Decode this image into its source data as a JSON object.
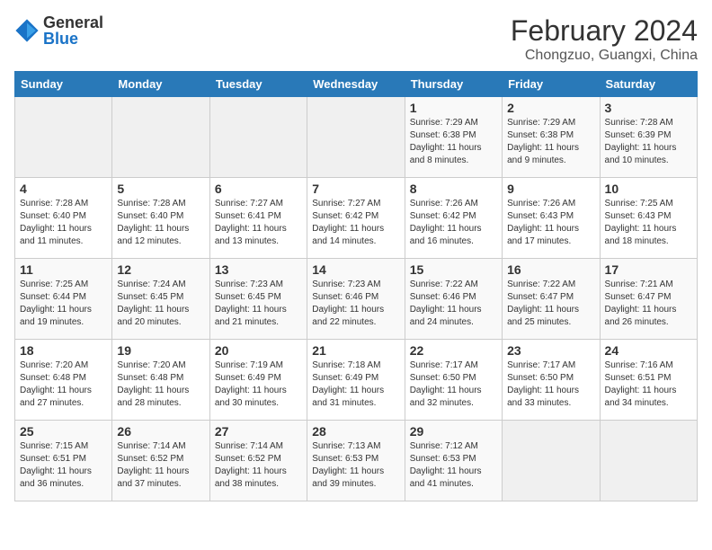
{
  "header": {
    "logo_general": "General",
    "logo_blue": "Blue",
    "title": "February 2024",
    "subtitle": "Chongzuo, Guangxi, China"
  },
  "days_of_week": [
    "Sunday",
    "Monday",
    "Tuesday",
    "Wednesday",
    "Thursday",
    "Friday",
    "Saturday"
  ],
  "weeks": [
    [
      {
        "day": "",
        "info": ""
      },
      {
        "day": "",
        "info": ""
      },
      {
        "day": "",
        "info": ""
      },
      {
        "day": "",
        "info": ""
      },
      {
        "day": "1",
        "info": "Sunrise: 7:29 AM\nSunset: 6:38 PM\nDaylight: 11 hours and 8 minutes."
      },
      {
        "day": "2",
        "info": "Sunrise: 7:29 AM\nSunset: 6:38 PM\nDaylight: 11 hours and 9 minutes."
      },
      {
        "day": "3",
        "info": "Sunrise: 7:28 AM\nSunset: 6:39 PM\nDaylight: 11 hours and 10 minutes."
      }
    ],
    [
      {
        "day": "4",
        "info": "Sunrise: 7:28 AM\nSunset: 6:40 PM\nDaylight: 11 hours and 11 minutes."
      },
      {
        "day": "5",
        "info": "Sunrise: 7:28 AM\nSunset: 6:40 PM\nDaylight: 11 hours and 12 minutes."
      },
      {
        "day": "6",
        "info": "Sunrise: 7:27 AM\nSunset: 6:41 PM\nDaylight: 11 hours and 13 minutes."
      },
      {
        "day": "7",
        "info": "Sunrise: 7:27 AM\nSunset: 6:42 PM\nDaylight: 11 hours and 14 minutes."
      },
      {
        "day": "8",
        "info": "Sunrise: 7:26 AM\nSunset: 6:42 PM\nDaylight: 11 hours and 16 minutes."
      },
      {
        "day": "9",
        "info": "Sunrise: 7:26 AM\nSunset: 6:43 PM\nDaylight: 11 hours and 17 minutes."
      },
      {
        "day": "10",
        "info": "Sunrise: 7:25 AM\nSunset: 6:43 PM\nDaylight: 11 hours and 18 minutes."
      }
    ],
    [
      {
        "day": "11",
        "info": "Sunrise: 7:25 AM\nSunset: 6:44 PM\nDaylight: 11 hours and 19 minutes."
      },
      {
        "day": "12",
        "info": "Sunrise: 7:24 AM\nSunset: 6:45 PM\nDaylight: 11 hours and 20 minutes."
      },
      {
        "day": "13",
        "info": "Sunrise: 7:23 AM\nSunset: 6:45 PM\nDaylight: 11 hours and 21 minutes."
      },
      {
        "day": "14",
        "info": "Sunrise: 7:23 AM\nSunset: 6:46 PM\nDaylight: 11 hours and 22 minutes."
      },
      {
        "day": "15",
        "info": "Sunrise: 7:22 AM\nSunset: 6:46 PM\nDaylight: 11 hours and 24 minutes."
      },
      {
        "day": "16",
        "info": "Sunrise: 7:22 AM\nSunset: 6:47 PM\nDaylight: 11 hours and 25 minutes."
      },
      {
        "day": "17",
        "info": "Sunrise: 7:21 AM\nSunset: 6:47 PM\nDaylight: 11 hours and 26 minutes."
      }
    ],
    [
      {
        "day": "18",
        "info": "Sunrise: 7:20 AM\nSunset: 6:48 PM\nDaylight: 11 hours and 27 minutes."
      },
      {
        "day": "19",
        "info": "Sunrise: 7:20 AM\nSunset: 6:48 PM\nDaylight: 11 hours and 28 minutes."
      },
      {
        "day": "20",
        "info": "Sunrise: 7:19 AM\nSunset: 6:49 PM\nDaylight: 11 hours and 30 minutes."
      },
      {
        "day": "21",
        "info": "Sunrise: 7:18 AM\nSunset: 6:49 PM\nDaylight: 11 hours and 31 minutes."
      },
      {
        "day": "22",
        "info": "Sunrise: 7:17 AM\nSunset: 6:50 PM\nDaylight: 11 hours and 32 minutes."
      },
      {
        "day": "23",
        "info": "Sunrise: 7:17 AM\nSunset: 6:50 PM\nDaylight: 11 hours and 33 minutes."
      },
      {
        "day": "24",
        "info": "Sunrise: 7:16 AM\nSunset: 6:51 PM\nDaylight: 11 hours and 34 minutes."
      }
    ],
    [
      {
        "day": "25",
        "info": "Sunrise: 7:15 AM\nSunset: 6:51 PM\nDaylight: 11 hours and 36 minutes."
      },
      {
        "day": "26",
        "info": "Sunrise: 7:14 AM\nSunset: 6:52 PM\nDaylight: 11 hours and 37 minutes."
      },
      {
        "day": "27",
        "info": "Sunrise: 7:14 AM\nSunset: 6:52 PM\nDaylight: 11 hours and 38 minutes."
      },
      {
        "day": "28",
        "info": "Sunrise: 7:13 AM\nSunset: 6:53 PM\nDaylight: 11 hours and 39 minutes."
      },
      {
        "day": "29",
        "info": "Sunrise: 7:12 AM\nSunset: 6:53 PM\nDaylight: 11 hours and 41 minutes."
      },
      {
        "day": "",
        "info": ""
      },
      {
        "day": "",
        "info": ""
      }
    ]
  ]
}
